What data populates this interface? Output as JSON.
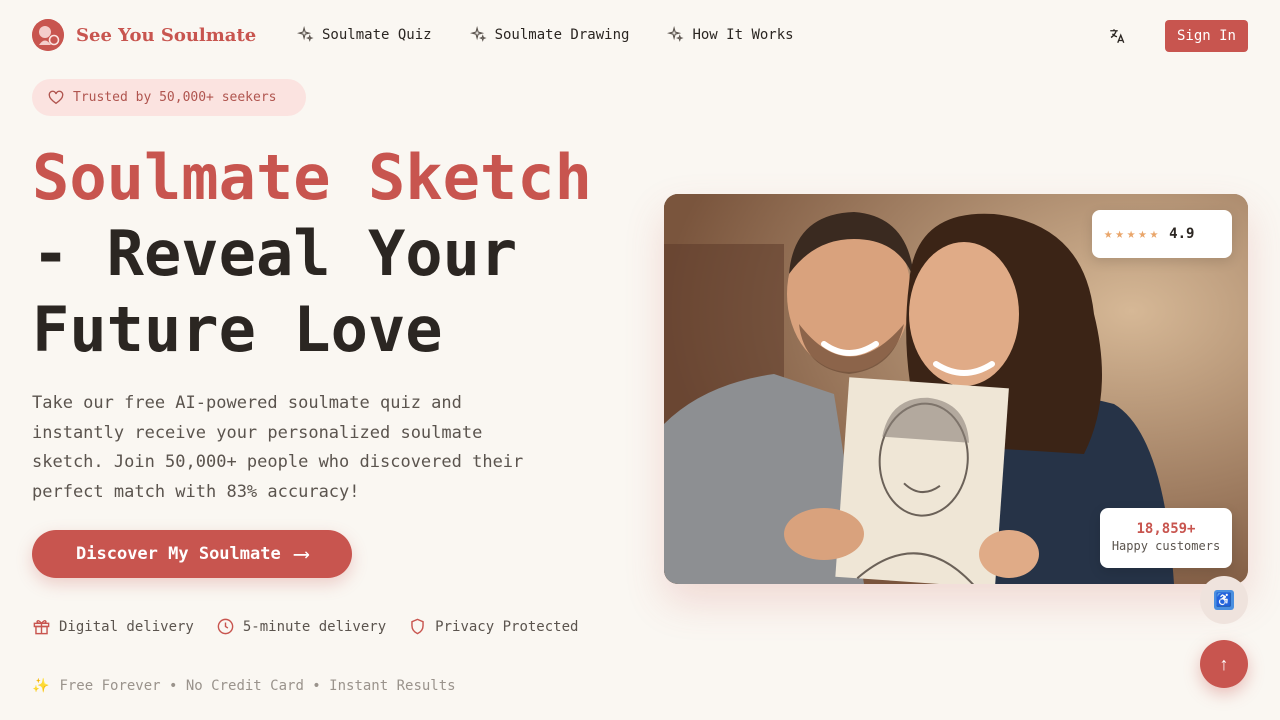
{
  "header": {
    "brand": "See You Soulmate",
    "nav": [
      {
        "label": "Soulmate Quiz",
        "icon": "sparkles-icon"
      },
      {
        "label": "Soulmate Drawing",
        "icon": "sparkles-icon"
      },
      {
        "label": "How It Works",
        "icon": "sparkles-icon"
      }
    ],
    "translate_icon": "translate-icon",
    "signin_label": "Sign In"
  },
  "hero": {
    "trust_badge": "Trusted by 50,000+ seekers",
    "title_accent": "Soulmate Sketch",
    "title_line2": "- Reveal Your",
    "title_line3": "Future Love",
    "description": "Take our free AI-powered soulmate quiz and instantly receive your personalized soulmate sketch. Join 50,000+ people who discovered their perfect match with 83% accuracy!",
    "cta_label": "Discover My Soulmate",
    "cta_arrow": "⟶",
    "features": [
      {
        "label": "Digital delivery",
        "icon": "gift-icon"
      },
      {
        "label": "5-minute delivery",
        "icon": "clock-icon"
      },
      {
        "label": "Privacy Protected",
        "icon": "shield-icon"
      }
    ],
    "tagline_icon": "✨",
    "tagline": "Free Forever • No Credit Card • Instant Results"
  },
  "photo": {
    "rating_stars": "★★★★★",
    "rating_value": "4.9",
    "customers_count": "18,859+",
    "customers_label": "Happy customers"
  },
  "floating": {
    "accessibility_icon": "♿",
    "back_to_top_icon": "↑"
  },
  "colors": {
    "accent": "#c8554f",
    "background": "#faf7f2",
    "badge_bg": "#fbe3e0",
    "star": "#e9a56a"
  }
}
